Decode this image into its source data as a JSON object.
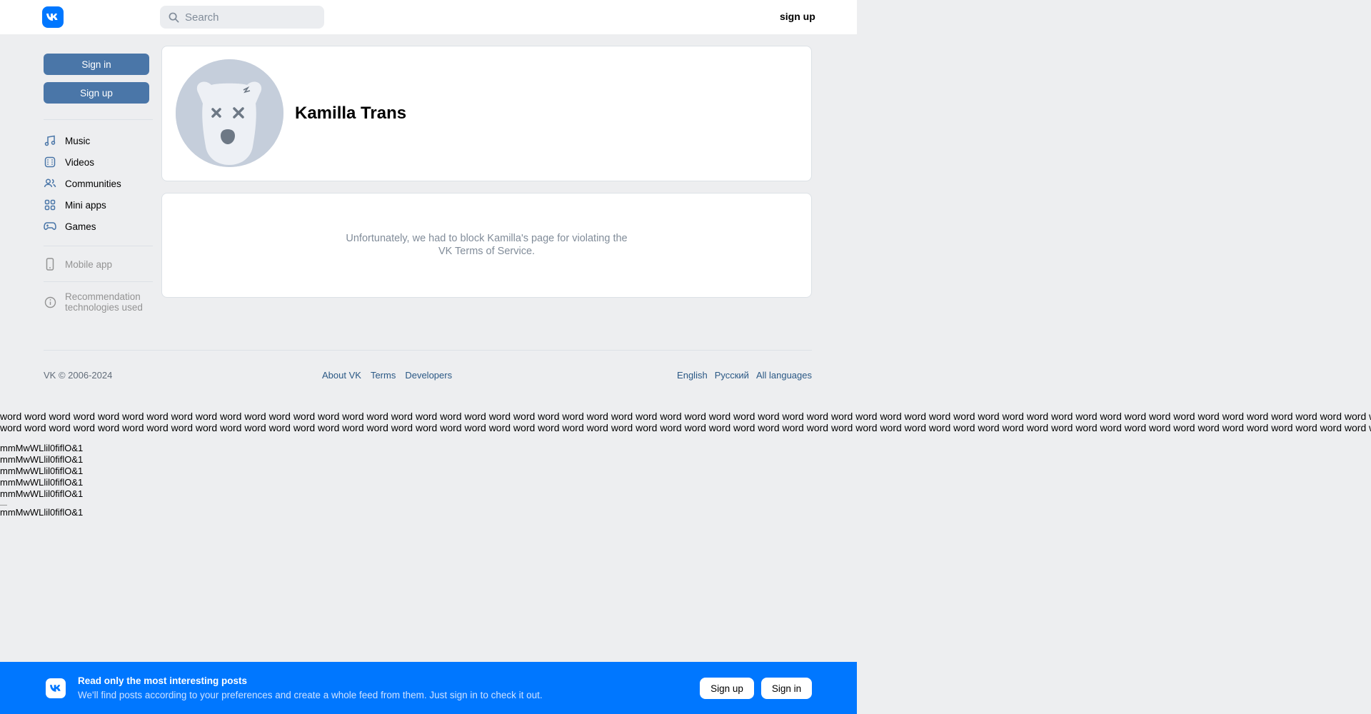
{
  "header": {
    "search_placeholder": "Search",
    "signup_link": "sign up"
  },
  "sidebar": {
    "signin_button": "Sign in",
    "signup_button": "Sign up",
    "items": [
      {
        "label": "Music",
        "icon": "music-note-icon"
      },
      {
        "label": "Videos",
        "icon": "video-icon"
      },
      {
        "label": "Communities",
        "icon": "users-icon"
      },
      {
        "label": "Mini apps",
        "icon": "grid-icon"
      },
      {
        "label": "Games",
        "icon": "gamepad-icon"
      }
    ],
    "mobile_app": "Mobile app",
    "recommendation_line1": "Recommendation",
    "recommendation_line2": "technologies used"
  },
  "profile": {
    "name": "Kamilla Trans"
  },
  "blocked": {
    "line1": "Unfortunately, we had to block Kamilla's page for violating the",
    "line2": "VK Terms of Service."
  },
  "footer": {
    "copyright": "VK © 2006-2024",
    "links": [
      "About VK",
      "Terms",
      "Developers"
    ],
    "languages": [
      "English",
      "Русский",
      "All languages"
    ]
  },
  "filler": {
    "word_line": "word word word word word word word word word word word word word word word word word word word word word word word word word word word word word word word word word word word word word word word word word word word word word word word word word word word word word word word word word word word word word word",
    "test_string": "mmMwWLlil0fiflO&1"
  },
  "banner": {
    "title": "Read only the most interesting posts",
    "subtitle": "We'll find posts according to your preferences and create a whole feed from them. Just sign in to check it out.",
    "signup_button": "Sign up",
    "signin_button": "Sign in"
  },
  "colors": {
    "brand": "#0077ff",
    "button": "#4a76a8",
    "link": "#2a5885",
    "background": "#edeef0"
  }
}
